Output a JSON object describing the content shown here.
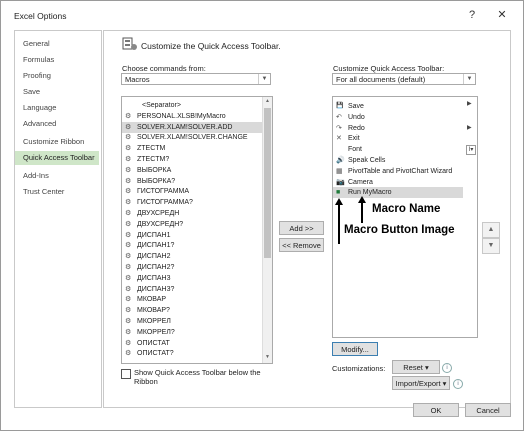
{
  "window": {
    "title": "Excel Options",
    "help": "?",
    "close": "✕"
  },
  "sidebar": {
    "items": [
      {
        "label": "General"
      },
      {
        "label": "Formulas"
      },
      {
        "label": "Proofing"
      },
      {
        "label": "Save"
      },
      {
        "label": "Language"
      },
      {
        "label": "Advanced"
      },
      {
        "label": "Customize Ribbon"
      },
      {
        "label": "Quick Access Toolbar"
      },
      {
        "label": "Add-Ins"
      },
      {
        "label": "Trust Center"
      }
    ],
    "selected": "Quick Access Toolbar"
  },
  "header": {
    "text": "Customize the Quick Access Toolbar."
  },
  "left": {
    "choose_label": "Choose commands from:",
    "choose_value": "Macros",
    "commands": [
      "<Separator>",
      "PERSONAL.XLSB!MyMacro",
      "SOLVER.XLAM!SOLVER.ADD",
      "SOLVER.XLAM!SOLVER.CHANGE",
      "ZTECTM",
      "ZTECTM?",
      "ВЫБОРКА",
      "ВЫБОРКА?",
      "ГИСТОГРАММА",
      "ГИСТОГРАММА?",
      "ДВУХСРЕДН",
      "ДВУХСРЕДН?",
      "ДИСПАН1",
      "ДИСПАН1?",
      "ДИСПАН2",
      "ДИСПАН2?",
      "ДИСПАН3",
      "ДИСПАН3?",
      "МКОВАР",
      "МКОВАР?",
      "МКОРРЕЛ",
      "МКОРРЕЛ?",
      "ОПИСТАТ",
      "ОПИСТАТ?"
    ],
    "selected_index": 2,
    "show_below_label": "Show Quick Access Toolbar below the Ribbon",
    "show_below_checked": false
  },
  "middle": {
    "add_label": "Add >>",
    "remove_label": "<< Remove"
  },
  "right": {
    "customize_label": "Customize Quick Access Toolbar:",
    "customize_value": "For all documents (default)",
    "items": [
      {
        "label": "Save",
        "icon": "save-icon",
        "glyph": "💾"
      },
      {
        "label": "Undo",
        "icon": "undo-icon",
        "glyph": "↶"
      },
      {
        "label": "Redo",
        "icon": "redo-icon",
        "glyph": "↷"
      },
      {
        "label": "Exit",
        "icon": "exit-icon",
        "glyph": "✕"
      },
      {
        "label": "Font",
        "icon": "font-icon",
        "glyph": ""
      },
      {
        "label": "Speak Cells",
        "icon": "speak-cells-icon",
        "glyph": "🔊"
      },
      {
        "label": "PivotTable and PivotChart Wizard",
        "icon": "pivot-wizard-icon",
        "glyph": "▦"
      },
      {
        "label": "Camera",
        "icon": "camera-icon",
        "glyph": "📷"
      },
      {
        "label": "Run MyMacro",
        "icon": "macro-button-icon",
        "glyph": "■"
      }
    ],
    "selected_index": 8,
    "modify_label": "Modify...",
    "customizations_label": "Customizations:",
    "reset_label": "Reset ▾",
    "import_export_label": "Import/Export ▾"
  },
  "annotations": {
    "macro_name": "Macro Name",
    "macro_button_image": "Macro Button Image"
  },
  "footer": {
    "ok_label": "OK",
    "cancel_label": "Cancel"
  }
}
